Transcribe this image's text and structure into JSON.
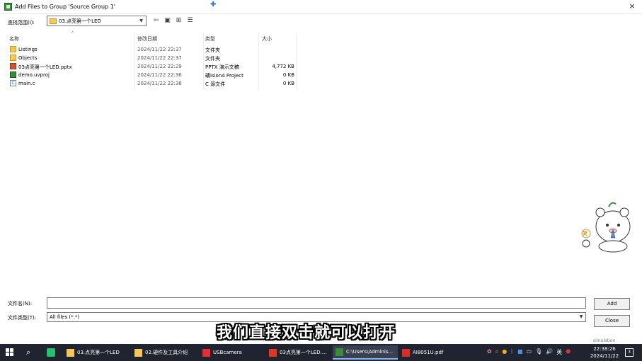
{
  "dialog": {
    "title": "Add Files to Group 'Source Group 1'",
    "close_glyph": "×"
  },
  "lookin": {
    "label": "查找范围(I):",
    "value": "03.点亮第一个LED"
  },
  "columns": {
    "name": "名称",
    "date": "修改日期",
    "type": "类型",
    "size": "大小"
  },
  "files": [
    {
      "name": "Listings",
      "date": "2024/11/22 22:37",
      "type": "文件夹",
      "size": "",
      "icon": "folder-icon"
    },
    {
      "name": "Objects",
      "date": "2024/11/22 22:37",
      "type": "文件夹",
      "size": "",
      "icon": "folder-icon"
    },
    {
      "name": "03点亮第一个LED.pptx",
      "date": "2024/11/22 22:29",
      "type": "PPTX 演示文稿",
      "size": "4,772 KB",
      "icon": "pptx-icon"
    },
    {
      "name": "demo.uvproj",
      "date": "2024/11/22 22:36",
      "type": "礦ision4 Project",
      "size": "0 KB",
      "icon": "uvproj-icon"
    },
    {
      "name": "main.c",
      "date": "2024/11/22 22:38",
      "type": "C 源文件",
      "size": "0 KB",
      "icon": "c-file-icon"
    }
  ],
  "filename": {
    "label": "文件名(N):",
    "value": ""
  },
  "filetype": {
    "label": "文件类型(T):",
    "value": "All files (*.*)"
  },
  "buttons": {
    "add": "Add",
    "close": "Close"
  },
  "faint": "simulation",
  "subtitle": "我们直接双击就可以打开",
  "taskbar": {
    "apps": [
      {
        "label": "03.点亮第一个LED",
        "color": "#f3c75a"
      },
      {
        "label": "02.硬件及工具介绍",
        "color": "#f3c75a"
      },
      {
        "label": "USBcamera",
        "color": "#e0303a"
      },
      {
        "label": "03点亮第一个LED....",
        "color": "#d83a2a"
      },
      {
        "label": "C:\\Users\\Adminis...",
        "color": "#3c8a3c"
      },
      {
        "label": "AI8051U.pdf",
        "color": "#d32f2f"
      }
    ],
    "tray_lang": "英",
    "clock_time": "22:38:26",
    "clock_date": "2024/11/22",
    "notif_count": "3"
  },
  "sticker": {
    "stamp_text": "笑"
  }
}
